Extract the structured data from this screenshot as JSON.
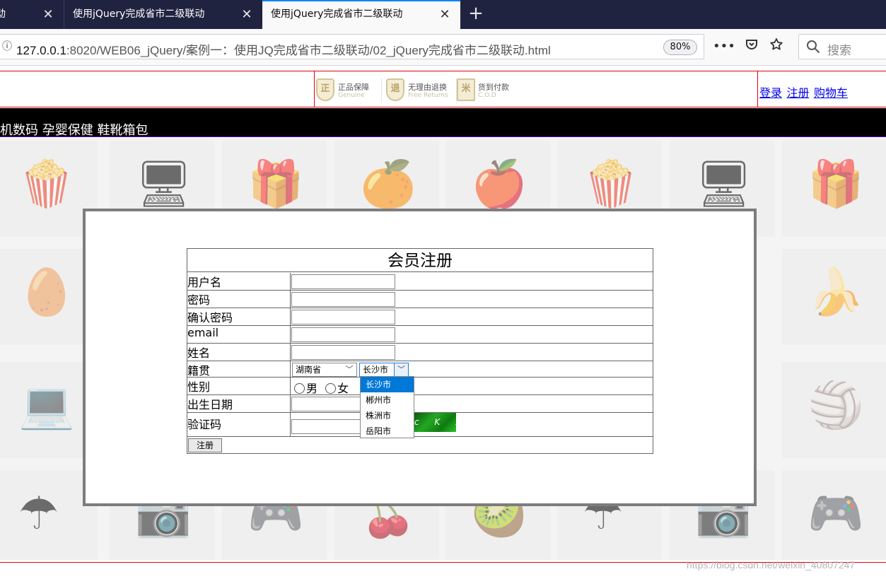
{
  "browser": {
    "tabs": [
      {
        "title": "动",
        "active": false
      },
      {
        "title": "使用jQuery完成省市二级联动",
        "active": false
      },
      {
        "title": "使用jQuery完成省市二级联动",
        "active": true
      }
    ],
    "close_glyph": "✕",
    "new_tab_glyph": "+",
    "url_host": "127.0.0.1",
    "url_rest": ":8020/WEB06_jQuery/案例一：使用JQ完成省市二级联动/02_jQuery完成省市二级联动.html",
    "zoom": "80%",
    "search_placeholder": "搜索",
    "icons": {
      "info": "info-icon",
      "more": "more-icon",
      "pocket": "pocket-icon",
      "bookmark": "star-icon",
      "search": "search-icon"
    }
  },
  "header": {
    "promos": [
      {
        "badge": "正",
        "title": "正品保障",
        "subtitle": "Genuine"
      },
      {
        "badge": "退",
        "title": "无理由退换",
        "subtitle": "Free Returns"
      },
      {
        "badge": "米",
        "title": "货到付款",
        "subtitle": "C.O.D"
      }
    ],
    "links": {
      "login": "登录",
      "register": "注册",
      "cart": "购物车"
    }
  },
  "category_bar": "机数码 孕婴保健 鞋靴箱包",
  "form": {
    "title": "会员注册",
    "labels": {
      "username": "用户名",
      "password": "密码",
      "confirm": "确认密码",
      "email": "email",
      "name": "姓名",
      "origin": "籍贯",
      "gender": "性别",
      "birthday": "出生日期",
      "captcha": "验证码"
    },
    "province": "湖南省",
    "city": "长沙市",
    "gender_options": {
      "male": "男",
      "female": "女"
    },
    "captcha_text": "c K x",
    "submit": "注册",
    "city_options": [
      "长沙市",
      "郴州市",
      "株洲市",
      "岳阳市"
    ]
  },
  "watermark": "https://blog.csdn.net/weixin_40807247"
}
